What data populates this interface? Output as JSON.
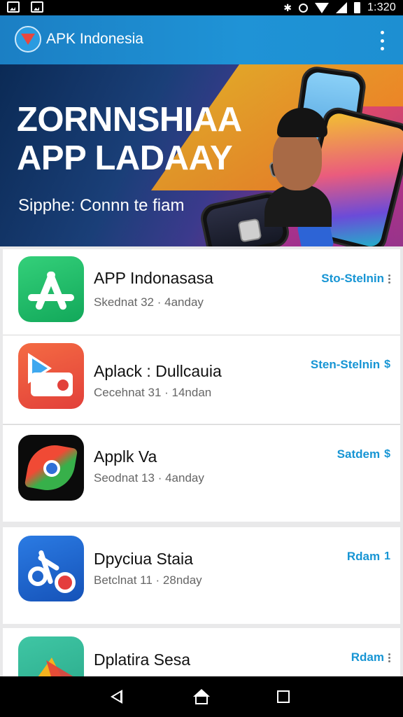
{
  "status_bar": {
    "time": "1:320",
    "bluetooth_glyph": "✱"
  },
  "app_bar": {
    "title": "APK Indonesia"
  },
  "banner": {
    "headline_line1": "ZORNNSHIAA",
    "headline_line2": "APP LADAAY",
    "subtitle": "Sipphe: Connn te fiam"
  },
  "apps": [
    {
      "name": "APP Indonasasa",
      "meta": "Skednat 32 · 4anday",
      "action": "Sto-Stelnin",
      "icon": "green-a-icon"
    },
    {
      "name": "Aplack : Dullcauia",
      "meta": "Cecehnat 31 · 14ndan",
      "action": "Sten-Stelnin",
      "icon": "play-store-icon"
    },
    {
      "name": "Applk Va",
      "meta": "Seodnat 13 · 4anday",
      "action": "Satdem",
      "icon": "chrome-leaf-icon"
    },
    {
      "name": "Dpyciua Staia",
      "meta": "Betclnat 11 · 28nday",
      "action": "Rdam",
      "icon": "blue-music-icon"
    },
    {
      "name": "Dplatira Sesa",
      "meta": "",
      "action": "Rdam",
      "icon": "polygon-icon"
    }
  ],
  "action_glyphs": [
    "⋮",
    "$",
    "$",
    "1",
    "⋮"
  ],
  "colors": {
    "accent": "#1795d4",
    "app_bar": "#1f93d6"
  }
}
